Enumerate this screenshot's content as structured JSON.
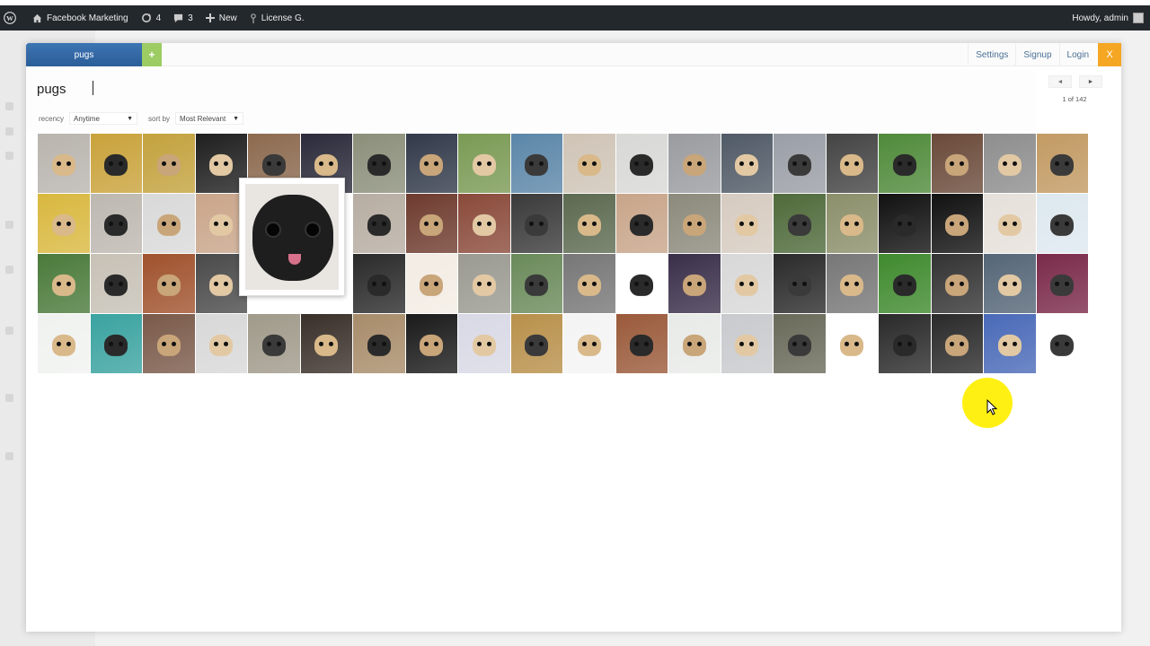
{
  "adminbar": {
    "site_name": "Facebook Marketing",
    "updates_count": "4",
    "comments_count": "3",
    "new_label": "New",
    "license_label": "License G.",
    "howdy": "Howdy, admin"
  },
  "tabs": {
    "active_label": "pugs",
    "add_label": "+"
  },
  "toplinks": {
    "settings": "Settings",
    "signup": "Signup",
    "login": "Login",
    "close": "X"
  },
  "search": {
    "query": "pugs"
  },
  "filters": {
    "recency_label": "recency",
    "recency_value": "Anytime",
    "sort_label": "sort by",
    "sort_value": "Most Relevant"
  },
  "pager": {
    "prev": "◄",
    "next": "►",
    "count": "1 of 142"
  },
  "colors": {
    "accent_tab": "#2f66a5",
    "add_tab": "#9ccc63",
    "close_button": "#f5a623",
    "adminbar": "#23282d",
    "cursor_highlight": "#ffef00"
  },
  "grid": {
    "thumb_colors": [
      "#b9b4ae",
      "#c9a23a",
      "#c3a23d",
      "#1f1f1f",
      "#8c6a4f",
      "#2a2a3a",
      "#8b8f7a",
      "#323a4a",
      "#7a9a54",
      "#5b86a8",
      "#cfc4b6",
      "#d8d8d6",
      "#9a9ca0",
      "#505a66",
      "#9a9ea6",
      "#444444",
      "#4f8a3a",
      "#6a4a3a",
      "#8e8e8e",
      "#c29a63",
      "#d9b83f",
      "#bdb8b0",
      "#d9d9d9",
      "#c9a58a",
      "#ffffff",
      "#ffffff",
      "#b7ada2",
      "#6e3b2e",
      "#8a4a3a",
      "#3a3a3a",
      "#5c6a50",
      "#c8a58a",
      "#8c8a7c",
      "#d6cbc0",
      "#4f6a3a",
      "#8b8f6a",
      "#111111",
      "#111111",
      "#e6e0da",
      "#dde8ef",
      "#4a7a3a",
      "#c7c1b6",
      "#a0522d",
      "#4a4a4a",
      "#ffffff",
      "#ffffff",
      "#2a2a2a",
      "#f3ece4",
      "#9a9a92",
      "#6a8a5a",
      "#777777",
      "#ffffff",
      "#3a2f4a",
      "#d8d8d8",
      "#2a2a2a",
      "#777777",
      "#3f8a2e",
      "#333333",
      "#556677",
      "#7a2a4a",
      "#f0f2f0",
      "#3aa3a0",
      "#7a5a4a",
      "#d8d8d8",
      "#a09a8a",
      "#3a302a",
      "#a88c6a",
      "#1a1a1a",
      "#d9d9e6",
      "#b8904a",
      "#f4f4f4",
      "#9a5a3a",
      "#e8eae8",
      "#c8cacd",
      "#6a6a5a",
      "#ffffff",
      "#2a2a2a",
      "#2a2a2a",
      "#4a6ab8",
      "#ffffff"
    ]
  }
}
